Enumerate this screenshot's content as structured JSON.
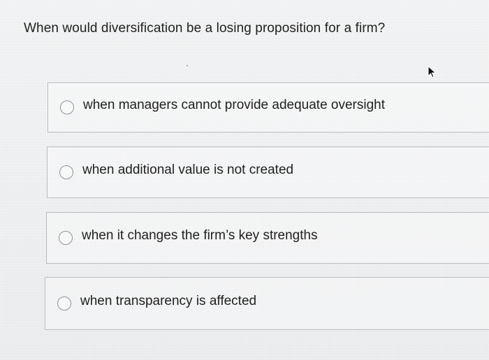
{
  "quiz": {
    "question": "When would diversification be a losing proposition for a firm?",
    "options": [
      {
        "label": "when managers cannot provide adequate oversight"
      },
      {
        "label": "when additional value is not created"
      },
      {
        "label": "when it changes the firm’s key strengths"
      },
      {
        "label": "when transparency is affected"
      }
    ]
  },
  "icons": {
    "radio": "radio-unselected-icon",
    "pointer": "mouse-pointer-icon"
  },
  "colors": {
    "text": "#1f1f1f",
    "border": "#b9bcc0",
    "radio_border": "#8f9397",
    "background": "#eef0f1"
  }
}
